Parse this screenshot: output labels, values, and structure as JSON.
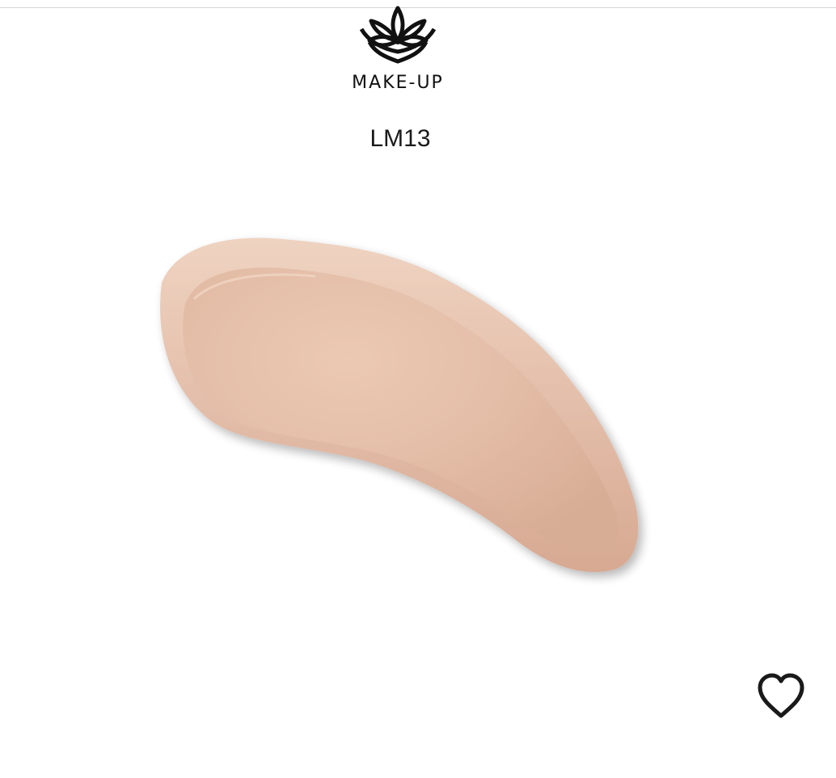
{
  "brand": {
    "wordmark": "MAKE-UP",
    "logo_icon": "lotus-logo-icon"
  },
  "product": {
    "shade_code": "LM13",
    "swatch_color": "#E2BCA6"
  },
  "actions": {
    "favorite_icon": "heart-outline-icon"
  },
  "colors": {
    "text": "#111111",
    "divider": "#D6D6D6",
    "background": "#FFFFFF"
  }
}
